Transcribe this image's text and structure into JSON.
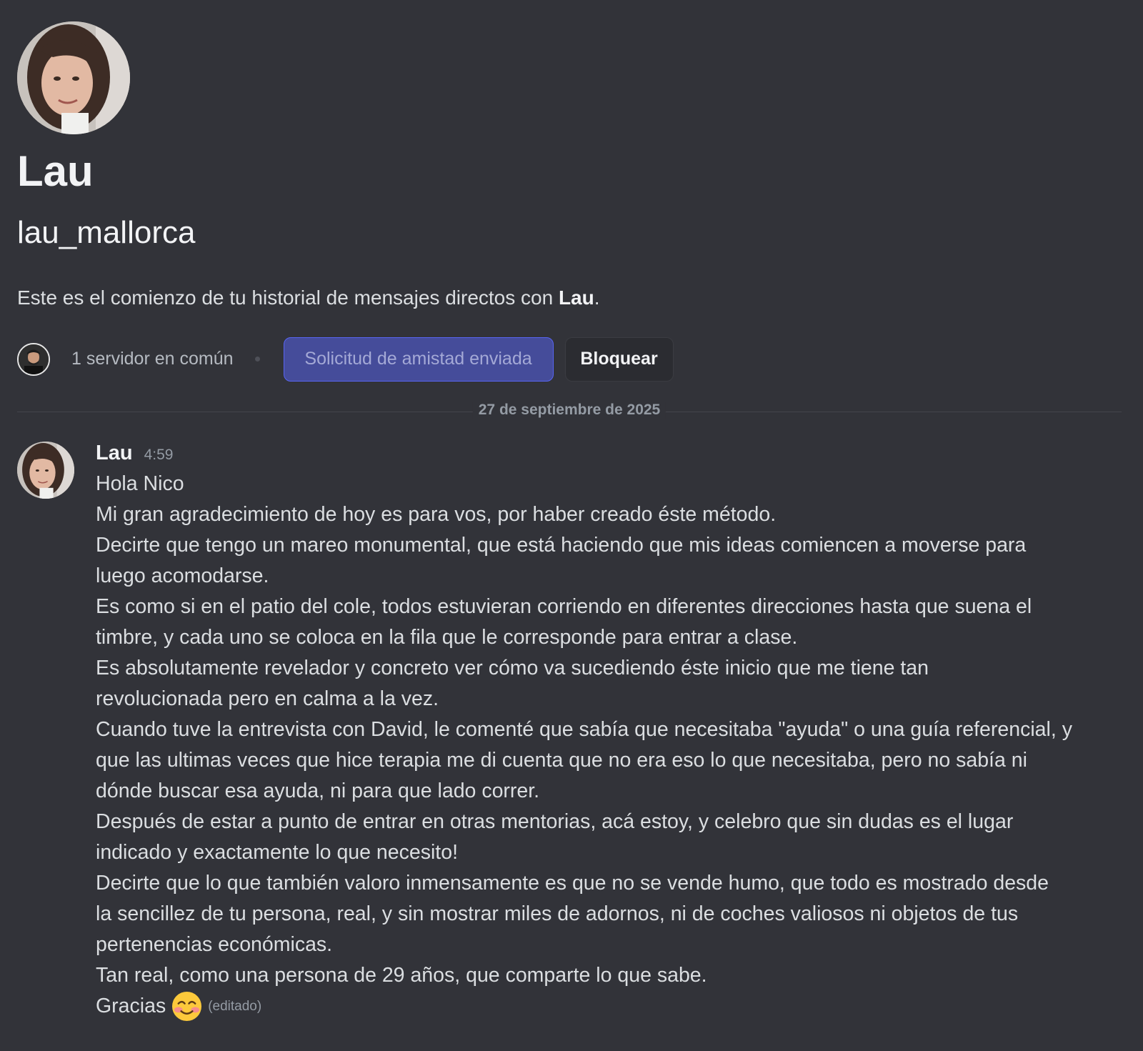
{
  "profile": {
    "display_name": "Lau",
    "username": "lau_mallorca",
    "intro_prefix": "Este es el comienzo de tu historial de mensajes directos con ",
    "intro_name": "Lau",
    "intro_suffix": ".",
    "mutual_servers": "1 servidor en común",
    "friend_request_label": "Solicitud de amistad enviada",
    "block_label": "Bloquear"
  },
  "date_divider": "27 de septiembre de 2025",
  "message": {
    "author": "Lau",
    "time": "4:59",
    "lines": [
      "Hola Nico",
      "Mi gran agradecimiento de hoy es para vos, por haber creado éste método.",
      "Decirte que tengo un mareo monumental, que está haciendo que mis ideas comiencen a moverse para",
      "luego acomodarse.",
      "Es como si en el patio del cole, todos estuvieran corriendo en diferentes direcciones hasta que suena el",
      "timbre, y cada uno se coloca en la fila que le corresponde para entrar a clase.",
      "Es absolutamente revelador y concreto ver cómo va sucediendo éste inicio que me tiene tan",
      "revolucionada pero en calma a la vez.",
      "Cuando tuve la entrevista con David, le comenté que sabía que necesitaba \"ayuda\" o una guía referencial, y",
      "que las ultimas veces que hice terapia me di cuenta que no era eso lo que necesitaba, pero no sabía ni",
      "dónde buscar esa ayuda, ni para que lado correr.",
      "Después de estar a punto de entrar en otras mentorias, acá estoy, y celebro que sin dudas es el lugar",
      "indicado y exactamente lo que necesito!",
      "Decirte  que lo que también valoro inmensamente es que no se vende humo, que todo es mostrado desde",
      "la sencillez de tu persona, real, y sin mostrar miles de adornos, ni de coches valiosos ni objetos de tus",
      "pertenencias económicas.",
      "Tan real, como una persona de 29 años, que comparte lo que sabe."
    ],
    "last_line": "Gracias",
    "emoji": "smiling-face-with-blush",
    "edited_label": "(editado)"
  }
}
